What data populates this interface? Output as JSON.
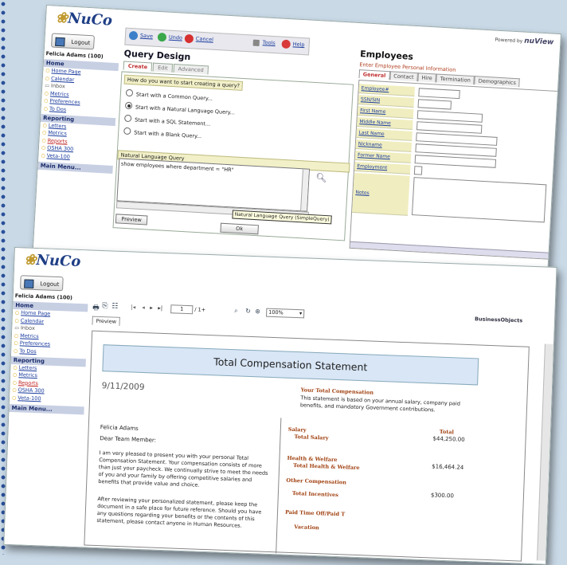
{
  "brand": {
    "logo": "NuCo",
    "powered_by": "Powered by",
    "powered_brand": "nuView",
    "report_brand": "BusinessObjects"
  },
  "sidebar": {
    "logout": "Logout",
    "user": "Felicia Adams (100)",
    "home_header": "Home",
    "home_items": [
      "Home Page",
      "Calendar",
      "Inbox",
      "Metrics",
      "Preferences",
      "To Dos"
    ],
    "reporting_header": "Reporting",
    "reporting_items": [
      "Letters",
      "Metrics",
      "Reports",
      "OSHA 300",
      "Veta-100"
    ],
    "main_menu": "Main Menu..."
  },
  "toolbar": {
    "save": "Save",
    "undo": "Undo",
    "cancel": "Cancel",
    "tools": "Tools",
    "help": "Help"
  },
  "query": {
    "title": "Query Design",
    "tabs": [
      "Create",
      "Edit",
      "Advanced"
    ],
    "prompt": "How do you want to start creating a query?",
    "options": [
      "Start with a Common Query...",
      "Start with a Natural Language Query...",
      "Start with a SQL Statement...",
      "Start with a Blank Query..."
    ],
    "selected_option": 1,
    "nl_header": "Natural Language Query",
    "nl_text": "show employees where department = \"HR\"",
    "tooltip": "Natural Language Query (SimpleQuery)",
    "preview": "Preview",
    "ok": "Ok"
  },
  "employees": {
    "title": "Employees",
    "subtitle": "Enter Employee Personal Information",
    "tabs": [
      "General",
      "Contact",
      "Hire",
      "Termination",
      "Demographics"
    ],
    "fields": [
      "Employee#",
      "SSN/SIN",
      "First Name",
      "Middle Name",
      "Last Name",
      "Nickname",
      "Former Name",
      "Employment Agreement",
      "Notes"
    ]
  },
  "viewer": {
    "page": "1",
    "of": "/ 1+",
    "zoom": "100%",
    "preview_tab": "Preview"
  },
  "statement": {
    "title": "Total Compensation Statement",
    "date": "9/11/2009",
    "name": "Felicia Adams",
    "greeting": "Dear Team Member:",
    "para1": "I am very pleased to present you with your personal Total Compensation Statement.  Your compensation consists of more than just your paycheck.  We continually strive to meet the needs of you and your family by offering competitive salaries and benefits that provide value and choice.",
    "para2": "After reviewing your personalized statement, please keep the document in a safe place for future reference.  Should you have any questions regarding your benefits or the contents of this statement, please contact anyone in Human Resources.",
    "right_heading": "Your Total Compensation",
    "right_text": "This statement is based on your annual salary, company paid benefits, and mandatory Government contributions.",
    "total_label": "Total",
    "salary_section": "Salary",
    "salary_label": "Total Salary",
    "salary_value": "$44,250.00",
    "hw_section": "Health & Welfare",
    "hw_label": "Total Health & Welfare",
    "hw_value": "$16,464.24",
    "other_section": "Other Compensation",
    "incentives_label": "Total Incentives",
    "incentives_value": "$300.00",
    "pto_section": "Paid Time Off/Paid T",
    "vacation_label": "Vacation"
  }
}
